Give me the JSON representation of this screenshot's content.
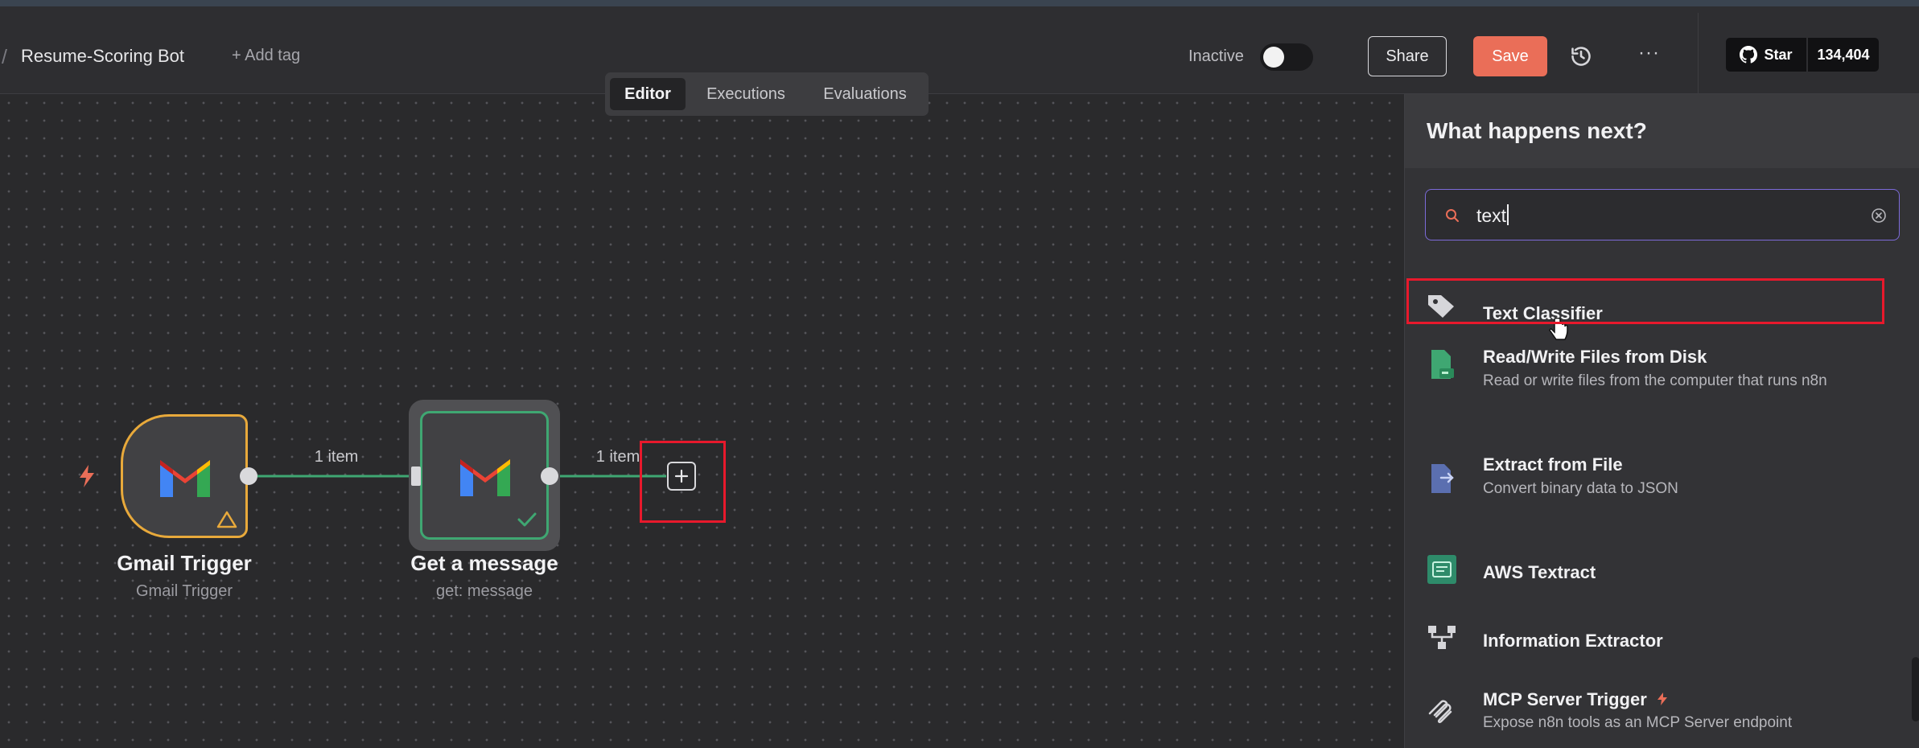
{
  "header": {
    "separator": "/",
    "workflow_name": "Resume-Scoring Bot",
    "add_tag": "+ Add tag",
    "status_label": "Inactive",
    "share_label": "Share",
    "save_label": "Save",
    "more_label": "···",
    "github": {
      "star_label": "Star",
      "star_count": "134,404"
    }
  },
  "tabs": [
    {
      "label": "Editor",
      "active": true
    },
    {
      "label": "Executions",
      "active": false
    },
    {
      "label": "Evaluations",
      "active": false
    }
  ],
  "canvas": {
    "nodes": [
      {
        "title": "Gmail Trigger",
        "subtitle": "Gmail Trigger",
        "icon": "gmail-icon",
        "status_icon": "warning-icon"
      },
      {
        "title": "Get a message",
        "subtitle": "get: message",
        "icon": "gmail-icon",
        "status_icon": "check-icon"
      }
    ],
    "edges": [
      {
        "label": "1 item"
      },
      {
        "label": "1 item"
      }
    ],
    "add_node_icon": "plus-icon",
    "trigger_icon": "lightning-icon"
  },
  "panel": {
    "title": "What happens next?",
    "search": {
      "value": "text",
      "icon": "search-icon"
    },
    "results": [
      {
        "title": "Text Classifier",
        "description": "",
        "icon": "tag-icon"
      },
      {
        "title": "Read/Write Files from Disk",
        "description": "Read or write files from the computer that runs n8n",
        "icon": "file-disk-icon"
      },
      {
        "title": "Extract from File",
        "description": "Convert binary data to JSON",
        "icon": "file-extract-icon"
      },
      {
        "title": "AWS Textract",
        "description": "",
        "icon": "aws-textract-icon"
      },
      {
        "title": "Information Extractor",
        "description": "",
        "icon": "hierarchy-icon"
      },
      {
        "title": "MCP Server Trigger",
        "description": "Expose n8n tools as an MCP Server endpoint",
        "icon": "mcp-icon"
      }
    ]
  },
  "colors": {
    "accent": "#ea6e58",
    "success": "#3fa772",
    "warning": "#e8a93b",
    "highlight": "#e8192c",
    "search_border": "#7c6bd8"
  }
}
